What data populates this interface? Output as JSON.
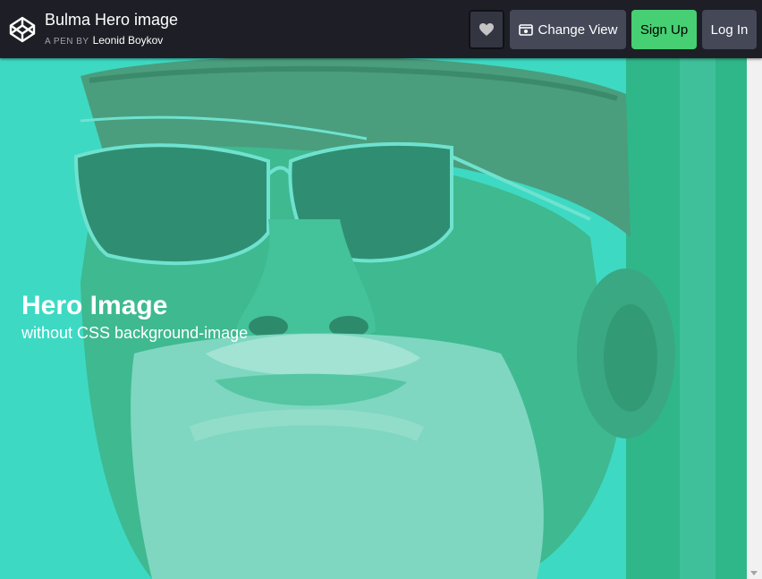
{
  "header": {
    "title": "Bulma Hero image",
    "byline_prefix": "A PEN BY",
    "author": "Leonid Boykov",
    "buttons": {
      "change_view": "Change View",
      "sign_up": "Sign Up",
      "log_in": "Log In"
    }
  },
  "hero": {
    "title": "Hero Image",
    "subtitle": "without CSS background-image",
    "overlay_color": "#2ed8b6"
  },
  "colors": {
    "topbar": "#1e1f26",
    "button_dark": "#444857",
    "sign_up": "#47cf73"
  },
  "icons": [
    "codepen-logo-icon",
    "heart-icon",
    "eye-icon",
    "scroll-down-arrow-icon"
  ]
}
